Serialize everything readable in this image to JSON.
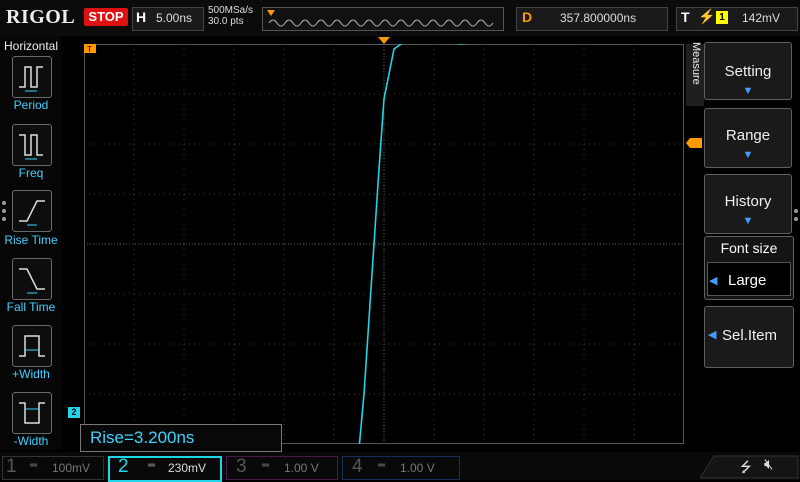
{
  "brand": "RIGOL",
  "run_state": "STOP",
  "horizontal": {
    "key": "H",
    "timebase": "5.00ns",
    "sample_rate": "500MSa/s",
    "memory_depth": "30.0 pts"
  },
  "delay": {
    "key": "D",
    "value": "357.800000ns"
  },
  "trigger": {
    "key": "T",
    "source": "1",
    "level": "142mV"
  },
  "left_panel": {
    "title": "Horizontal",
    "items": [
      {
        "label": "Period",
        "icon": "period-icon"
      },
      {
        "label": "Freq",
        "icon": "frequency-icon"
      },
      {
        "label": "Rise Time",
        "icon": "rise-time-icon"
      },
      {
        "label": "Fall Time",
        "icon": "fall-time-icon"
      },
      {
        "label": "+Width",
        "icon": "positive-width-icon"
      },
      {
        "label": "-Width",
        "icon": "negative-width-icon"
      }
    ]
  },
  "right_panel": {
    "tab": "Measure",
    "buttons": [
      {
        "label": "Setting"
      },
      {
        "label": "Range"
      },
      {
        "label": "History"
      }
    ],
    "font_size": {
      "title": "Font size",
      "value": "Large"
    },
    "sel_item": "Sel.Item"
  },
  "measurement": {
    "text": "Rise=3.200ns"
  },
  "channels": [
    {
      "num": "1",
      "scale": "100mV",
      "color": "#b8b800"
    },
    {
      "num": "2",
      "scale": "230mV",
      "color": "#1fd6e8"
    },
    {
      "num": "3",
      "scale": "1.00 V",
      "color": "#c020c0"
    },
    {
      "num": "4",
      "scale": "1.00 V",
      "color": "#2a4fd0"
    }
  ],
  "ch2_marker": "2",
  "colors": {
    "trace": "#1fd6e8",
    "grid": "#3a3a3a",
    "accent": "#3fa0ff",
    "stop": "#d11111",
    "trigger": "#ff9900"
  },
  "chart_data": {
    "type": "line",
    "x_label": "",
    "y_label": "",
    "x_divisions": 12,
    "y_divisions": 8,
    "x_unit_per_div": "5.00ns",
    "series": [
      {
        "x": [
          0,
          2,
          4,
          5.2,
          5.4,
          5.5,
          5.6,
          5.7,
          5.8,
          5.9,
          6.0,
          6.2,
          6.4,
          7.0,
          7.5,
          8.5,
          10,
          12
        ],
        "y": [
          -4.84,
          -4.84,
          -4.82,
          -4.86,
          -4.7,
          -4.1,
          -3.0,
          -1.5,
          0.0,
          1.5,
          2.9,
          3.9,
          4.04,
          4.18,
          4.0,
          4.08,
          4.04,
          4.04
        ]
      }
    ]
  }
}
